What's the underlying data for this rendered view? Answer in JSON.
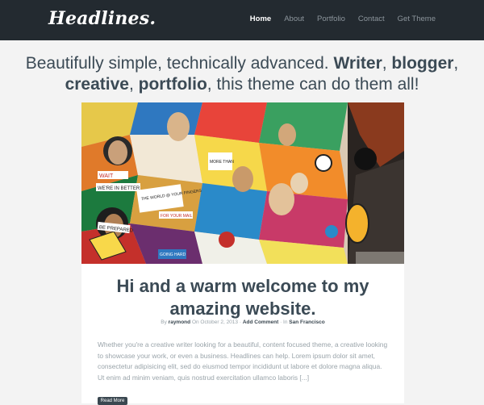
{
  "site": {
    "logo": "Headlines."
  },
  "nav": {
    "items": [
      {
        "label": "Home",
        "active": true
      },
      {
        "label": "About",
        "active": false
      },
      {
        "label": "Portfolio",
        "active": false
      },
      {
        "label": "Contact",
        "active": false
      },
      {
        "label": "Get Theme",
        "active": false
      }
    ]
  },
  "tagline": {
    "intro": "Beautifully simple, technically advanced.",
    "writer": "Writer",
    "blogger": "blogger",
    "creative": "creative",
    "portfolio": "portfolio",
    "rest": "this theme can do them all!"
  },
  "post": {
    "title_line1": "Hi and a warm welcome to my",
    "title_line2": "amazing website.",
    "meta": {
      "by": "By",
      "author": "raymond",
      "on": "On October 2, 2013",
      "sep1": "·",
      "comment": "Add Comment",
      "sep2": "·",
      "in": "In",
      "category": "San Francisco"
    },
    "excerpt": "Whether you're a creative writer looking for a beautiful, content focused theme, a creative looking to showcase your work, or even a business. Headlines can help. Lorem ipsum dolor sit amet, consectetur adipisicing elit, sed do eiusmod tempor incididunt ut labore et dolore magna aliqua. Ut enim ad minim veniam, quis nostrud exercitation ullamco laboris [...]",
    "read_more": "Read More"
  },
  "mural_text": {
    "l1": "WAIT",
    "l2": "WE'RE IN BETTER",
    "l3": "THE WORLD @ YOUR FINGERS",
    "l4": "MORE THAN",
    "l5": "FOR YOUR MAIL",
    "l6": "BE PREPARED",
    "l7": "GOING HARD"
  },
  "colors": {
    "header": "#232a30",
    "text": "#3a4750",
    "muted": "#9aa4aa",
    "bg": "#f3f3f3"
  }
}
